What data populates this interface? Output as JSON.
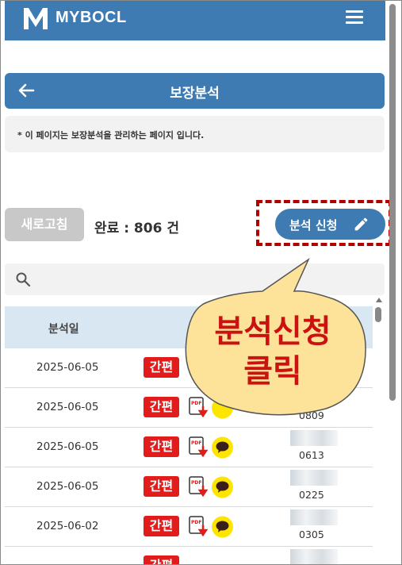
{
  "app": {
    "logo_letter": "M",
    "name": "MYBOCL"
  },
  "page": {
    "title": "보장분석",
    "notice": "* 이 페이지는 보장분석을 관리하는 페이지 입니다."
  },
  "toolbar": {
    "refresh_label": "새로고침",
    "count_label": "완료 : 806 건",
    "request_label": "분석 신청"
  },
  "search": {
    "placeholder": ""
  },
  "table": {
    "columns": [
      "분석일"
    ],
    "rows": [
      {
        "date": "2025-06-05",
        "badge": "간편",
        "number": ""
      },
      {
        "date": "2025-06-05",
        "badge": "간편",
        "number": "0809"
      },
      {
        "date": "2025-06-05",
        "badge": "간편",
        "number": "0613"
      },
      {
        "date": "2025-06-05",
        "badge": "간편",
        "number": "0225"
      },
      {
        "date": "2025-06-02",
        "badge": "간편",
        "number": "0305"
      },
      {
        "date": "",
        "badge": "간편",
        "number": ""
      }
    ]
  },
  "callout": {
    "line1": "분석신청",
    "line2": "클릭"
  },
  "colors": {
    "brand": "#3d7bb2",
    "badge_red": "#e21b1b",
    "kakao_yellow": "#fee500",
    "callout_fill": "#fde29a",
    "callout_text": "#cc1111",
    "highlight_dash": "#b00000"
  },
  "icons": [
    "logo-icon",
    "menu-icon",
    "back-arrow-icon",
    "pencil-icon",
    "search-icon",
    "pdf-download-icon",
    "kakao-talk-icon"
  ]
}
